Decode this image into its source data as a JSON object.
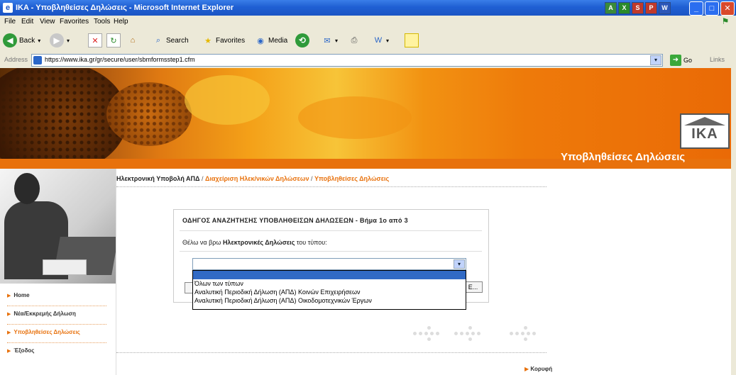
{
  "window": {
    "title": "IKA - Υποβληθείσες Δηλώσεις - Microsoft Internet Explorer",
    "taskbar_apps": [
      "A",
      "X",
      "S",
      "P",
      "W"
    ]
  },
  "menu": [
    "File",
    "Edit",
    "View",
    "Favorites",
    "Tools",
    "Help"
  ],
  "toolbar": {
    "back_label": "Back",
    "search_label": "Search",
    "favorites_label": "Favorites",
    "media_label": "Media"
  },
  "address": {
    "label": "Address",
    "url": "https://www.ika.gr/gr/secure/user/sbmformsstep1.cfm",
    "go_label": "Go",
    "links_label": "Links"
  },
  "banner": {
    "logo_text": "IKA",
    "subtitle": "Υποβληθείσες Δηλώσεις"
  },
  "sidebar": {
    "items": [
      {
        "label": "Home"
      },
      {
        "label": "Νέα/Εκκρεμής Δήλωση"
      },
      {
        "label": "Υποβληθείσες Δηλώσεις"
      },
      {
        "label": "Έξοδος"
      }
    ]
  },
  "breadcrumb": {
    "root": "Ηλεκτρονική Υποβολή ΑΠΔ",
    "sep": " / ",
    "second": "Διαχείριση Ηλεκ/νικών Δηλώσεων",
    "current": "Υποβληθείσες Δηλώσεις"
  },
  "wizard": {
    "heading": "ΟΔΗΓΟΣ ΑΝΑΖΗΤΗΣΗΣ ΥΠΟΒΛΗΘΕΙΣΩΝ ΔΗΛΩΣΕΩΝ - Βήμα 1ο από 3",
    "prompt_pre": "Θέλω να βρω ",
    "prompt_bold": "Ηλεκτρονικές Δηλώσεις",
    "prompt_post": " του τύπου:",
    "next_label": "Ε..."
  },
  "dropdown": {
    "options": [
      "",
      "Όλων των τύπων",
      "Αναλυτική Περιοδική Δήλωση (ΑΠΔ) Κοινών Επιχειρήσεων",
      "Αναλυτική Περιοδική Δήλωση (ΑΠΔ) Οικοδομοτεχνικών Έργων"
    ],
    "selected_index": 0
  },
  "footer": {
    "top_link": "Κορυφή"
  }
}
